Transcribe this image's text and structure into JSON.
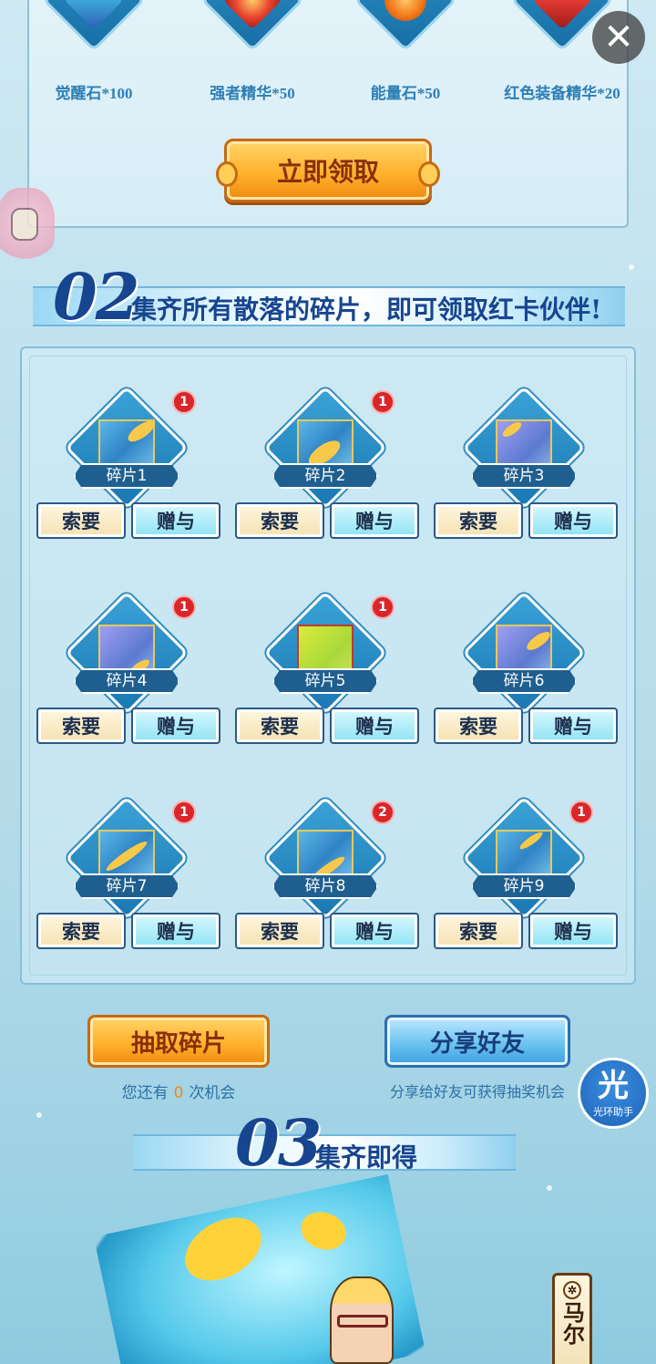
{
  "rewards": [
    {
      "label": "觉醒石*100",
      "icon": "awakening-stone-icon",
      "color": "#3ea8d8"
    },
    {
      "label": "强者精华*50",
      "icon": "champion-essence-icon",
      "color": "#e8422c"
    },
    {
      "label": "能量石*50",
      "icon": "energy-stone-icon",
      "color": "#f27a1a"
    },
    {
      "label": "红色装备精华*20",
      "icon": "red-equipment-essence-icon",
      "color": "#e33a32"
    }
  ],
  "claim_button": "立即领取",
  "close_icon": "✕",
  "section2": {
    "num": "02",
    "title": "集齐所有散落的碎片，即可领取红卡伙伴!"
  },
  "fragments": [
    {
      "label": "碎片1",
      "count": "1"
    },
    {
      "label": "碎片2",
      "count": "1"
    },
    {
      "label": "碎片3",
      "count": ""
    },
    {
      "label": "碎片4",
      "count": "1"
    },
    {
      "label": "碎片5",
      "count": "1"
    },
    {
      "label": "碎片6",
      "count": ""
    },
    {
      "label": "碎片7",
      "count": "1"
    },
    {
      "label": "碎片8",
      "count": "2"
    },
    {
      "label": "碎片9",
      "count": "1"
    }
  ],
  "fragment_actions": {
    "ask": "索要",
    "give": "赠与"
  },
  "draw": {
    "button": "抽取碎片",
    "note_prefix": "您还有",
    "chances": "0",
    "note_suffix": "次机会"
  },
  "share": {
    "button": "分享好友",
    "note": "分享给好友可获得抽奖机会"
  },
  "helper": {
    "glyph": "光",
    "label": "光环助手"
  },
  "section3": {
    "num": "03",
    "title": "集齐即得"
  },
  "character_name": "马尔"
}
